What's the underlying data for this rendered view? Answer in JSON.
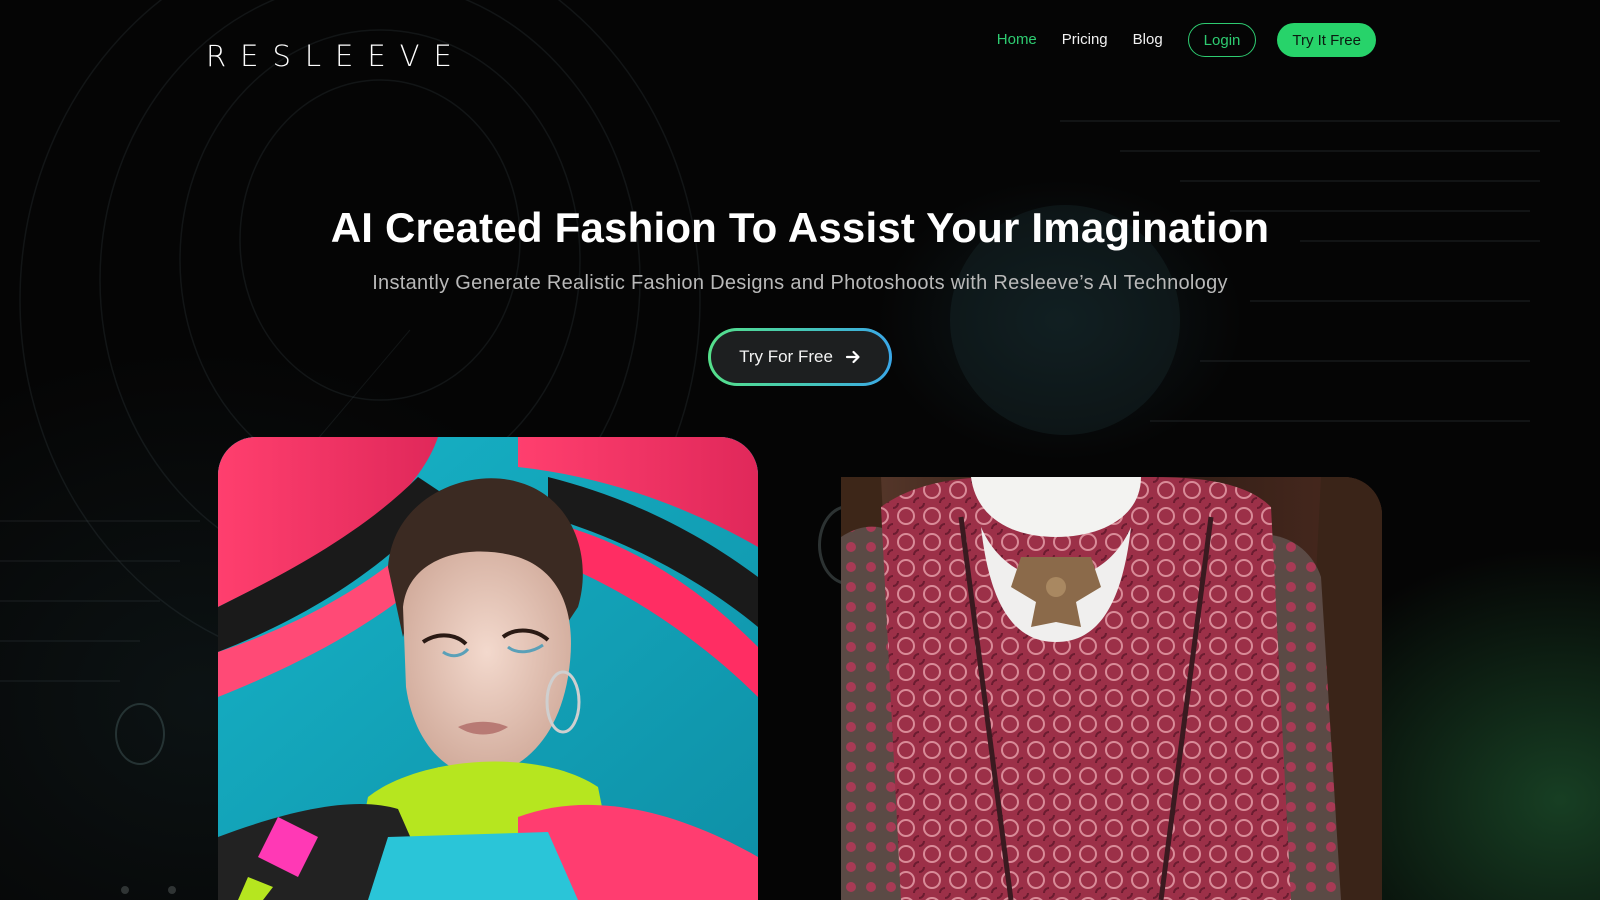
{
  "header": {
    "logo": "RESLEEVE",
    "nav": [
      {
        "label": "Home",
        "active": true
      },
      {
        "label": "Pricing",
        "active": false
      },
      {
        "label": "Blog",
        "active": false
      }
    ],
    "login_label": "Login",
    "try_label": "Try It Free"
  },
  "hero": {
    "title": "AI Created Fashion To Assist Your Imagination",
    "subtitle": "Instantly Generate Realistic Fashion Designs and Photoshoots with Resleeve’s AI Technology",
    "cta_label": "Try For Free",
    "cta_icon": "arrow-right-icon"
  },
  "gallery": {
    "images": [
      {
        "name": "fashion-model-portrait"
      },
      {
        "name": "lace-dress-photo"
      }
    ]
  },
  "colors": {
    "accent": "#27d36a",
    "background": "#050505",
    "cta_gradient": [
      "#55e08a",
      "#3aa7e8"
    ]
  }
}
